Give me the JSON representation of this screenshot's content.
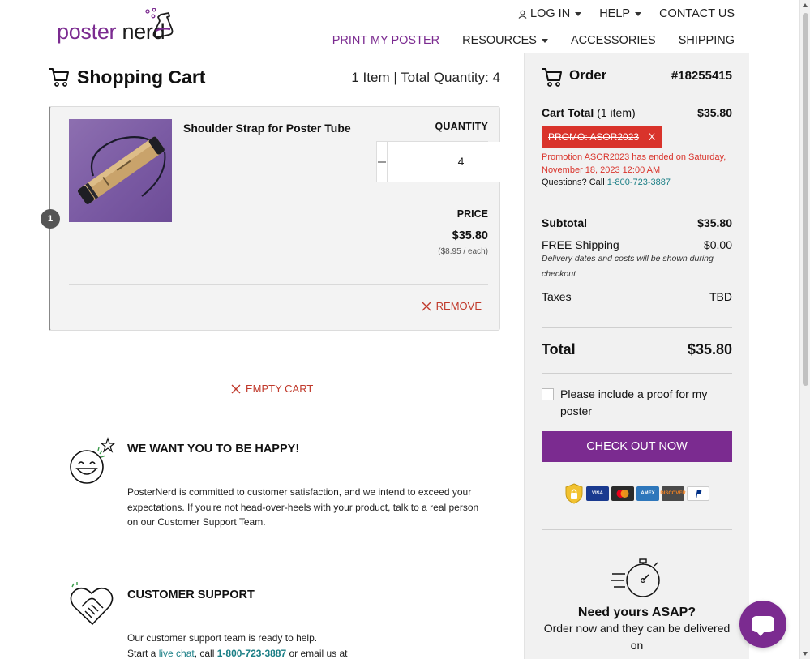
{
  "brand": {
    "logo_part1": "poster",
    "logo_part2": "nerd",
    "accent_color": "#7b2b90",
    "alert_color": "#d9332b",
    "link_color": "#1b7f86"
  },
  "topnav": {
    "login": "LOG IN",
    "help": "HELP",
    "contact": "CONTACT US"
  },
  "mainnav": {
    "print": "PRINT MY POSTER",
    "resources": "RESOURCES",
    "accessories": "ACCESSORIES",
    "shipping": "SHIPPING"
  },
  "cart": {
    "title": "Shopping Cart",
    "meta": "1 Item |  Total Quantity: 4",
    "item": {
      "index": "1",
      "name": "Shoulder Strap for Poster Tube",
      "quantity_label": "QUANTITY",
      "quantity": "4",
      "price_label": "PRICE",
      "price": "$35.80",
      "price_each": "($8.95 / each)",
      "remove": "REMOVE"
    },
    "empty_cart": "EMPTY CART"
  },
  "info": {
    "happy_title": "WE WANT YOU TO BE HAPPY!",
    "happy_body": "PosterNerd is committed to customer satisfaction, and we intend to exceed your expectations. If you're not head-over-heels with your product, talk to a real person on our Customer Support Team.",
    "support_title": "CUSTOMER SUPPORT",
    "support_line1": "Our customer support team is ready to help.",
    "support_start": "Start a ",
    "support_chat": "live chat",
    "support_call": ", call ",
    "support_phone": "1-800-723-3887",
    "support_end": " or email us at"
  },
  "order": {
    "label": "Order",
    "number": "#18255415",
    "cart_total_label": "Cart Total",
    "cart_total_count": " (1 item)",
    "cart_total": "$35.80",
    "promo_code": "PROMO: ASOR2023",
    "promo_remove": "X",
    "promo_msg": "Promotion ASOR2023 has ended on Saturday, November 18, 2023 12:00 AM",
    "questions": "Questions? Call ",
    "phone": "1-800-723-3887",
    "subtotal_label": "Subtotal",
    "subtotal": "$35.80",
    "shipping_label": "FREE Shipping",
    "shipping": "$0.00",
    "shipping_note": "Delivery dates and costs will be shown during checkout",
    "taxes_label": "Taxes",
    "taxes": "TBD",
    "total_label": "Total",
    "total": "$35.80",
    "proof_label": "Please include a proof for my poster",
    "checkout": "CHECK OUT NOW",
    "cards": [
      "VISA",
      "MC",
      "AMEX",
      "DISCOVER",
      "PayPal"
    ],
    "asap_title": "Need yours ASAP?",
    "asap_body": "Order now and they can be delivered on"
  }
}
